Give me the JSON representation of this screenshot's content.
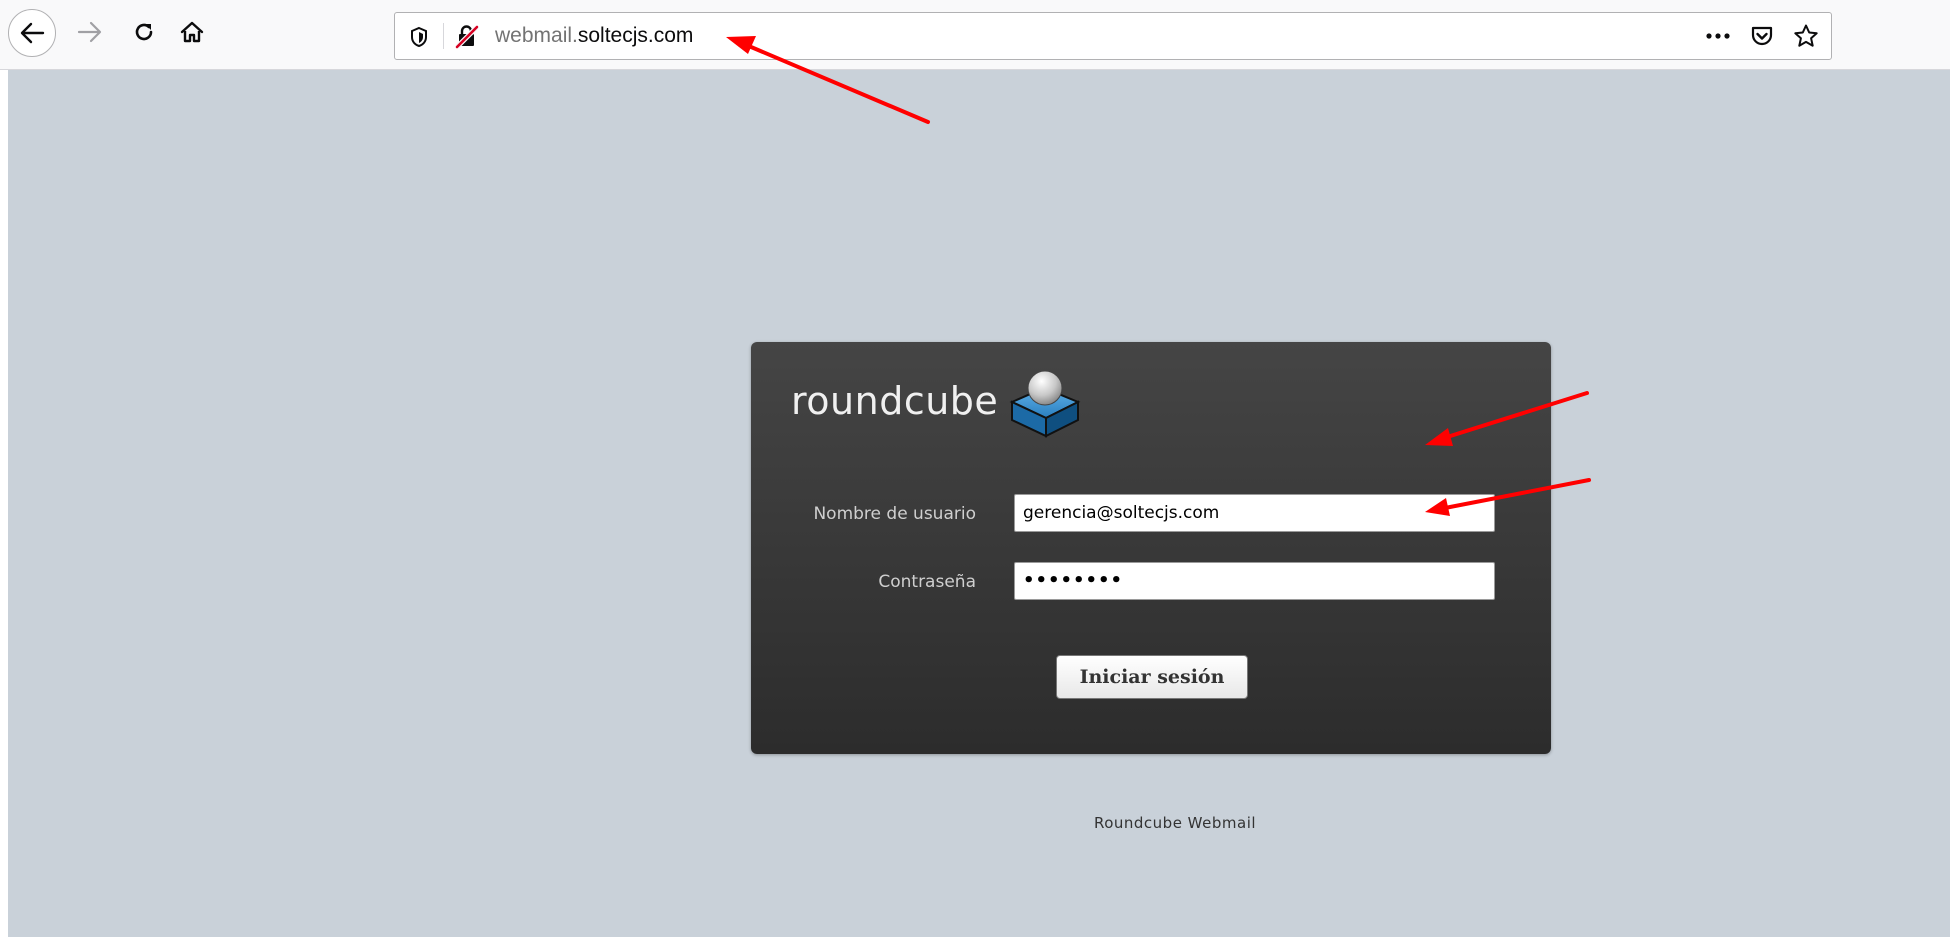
{
  "browser": {
    "url_prefix": "webmail.",
    "url_domain": "soltecjs.com",
    "icons": {
      "back": "arrow-left-icon",
      "forward": "arrow-right-icon",
      "reload": "reload-icon",
      "home": "home-icon",
      "tracking": "shield-icon",
      "insecure": "insecure-connection-icon",
      "page_actions": "more-dots-icon",
      "pocket": "pocket-icon",
      "bookmark": "star-icon"
    }
  },
  "login": {
    "logo_text": "roundcube",
    "username_label": "Nombre de usuario",
    "username_value": "gerencia@soltecjs.com",
    "password_label": "Contraseña",
    "password_value": "••••••••",
    "submit_label": "Iniciar sesión"
  },
  "footer": {
    "text": "Roundcube Webmail"
  },
  "colors": {
    "page_background": "#c9d1d9",
    "login_box": "#3a3a3a",
    "annotation_arrow": "#ff0000"
  }
}
